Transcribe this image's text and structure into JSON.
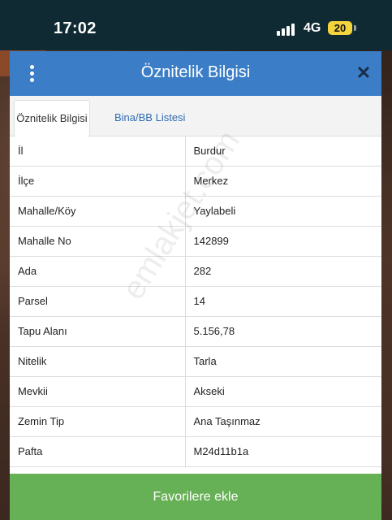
{
  "status_bar": {
    "time": "17:02",
    "network": "4G",
    "battery": "20"
  },
  "dialog": {
    "title": "Öznitelik Bilgisi",
    "tabs": [
      {
        "label": "Öznitelik Bilgisi",
        "active": true
      },
      {
        "label": "Bina/BB Listesi",
        "active": false
      }
    ],
    "rows": [
      {
        "key": "İl",
        "value": "Burdur"
      },
      {
        "key": "İlçe",
        "value": "Merkez"
      },
      {
        "key": "Mahalle/Köy",
        "value": "Yaylabeli"
      },
      {
        "key": "Mahalle No",
        "value": "142899"
      },
      {
        "key": "Ada",
        "value": "282"
      },
      {
        "key": "Parsel",
        "value": "14"
      },
      {
        "key": "Tapu Alanı",
        "value": "5.156,78"
      },
      {
        "key": "Nitelik",
        "value": "Tarla"
      },
      {
        "key": "Mevkii",
        "value": "Akseki"
      },
      {
        "key": "Zemin Tip",
        "value": "Ana Taşınmaz"
      },
      {
        "key": "Pafta",
        "value": "M24d11b1a"
      }
    ],
    "favorite_button": "Favorilere ekle"
  },
  "watermark": "emlakjet.com",
  "colors": {
    "header": "#3b7ec7",
    "button": "#66b056",
    "tab_link": "#2f6db4",
    "status_bar": "#0f2a33"
  }
}
